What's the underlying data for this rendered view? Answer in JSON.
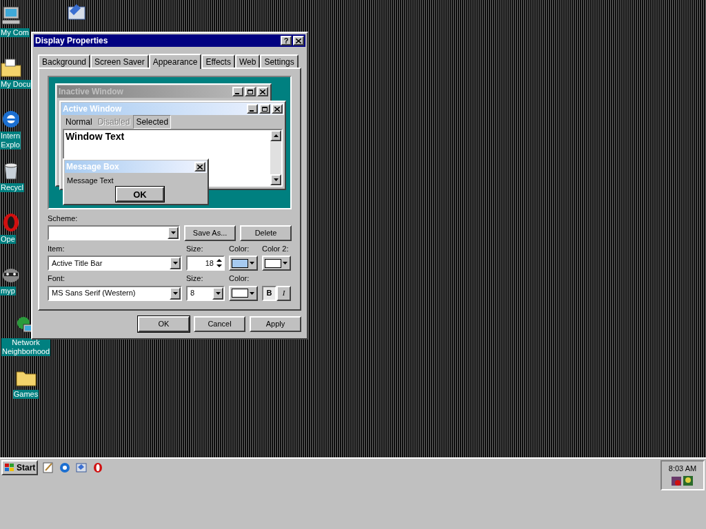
{
  "desktop_icons": [
    {
      "kind": "computer",
      "label": "My Com"
    },
    {
      "kind": "documents",
      "label": "My Docu"
    },
    {
      "kind": "browser",
      "label": "Intern",
      "label_2": "Explo"
    },
    {
      "kind": "recycle",
      "label": "Recycl"
    },
    {
      "kind": "opera",
      "label": "Ope"
    },
    {
      "kind": "raccoon",
      "label": "myp"
    },
    {
      "kind": "network",
      "label": "Network",
      "label_2": "Neighborhood"
    },
    {
      "kind": "folder",
      "label": "Games"
    }
  ],
  "dialog": {
    "title": "Display Properties",
    "help": "?",
    "tabs": [
      {
        "label": "Background",
        "selected": false
      },
      {
        "label": "Screen Saver",
        "selected": false
      },
      {
        "label": "Appearance",
        "selected": true
      },
      {
        "label": "Effects",
        "selected": false
      },
      {
        "label": "Web",
        "selected": false
      },
      {
        "label": "Settings",
        "selected": false
      }
    ],
    "preview": {
      "inactive_window": {
        "title": "Inactive Window"
      },
      "active_window": {
        "title": "Active Window",
        "menu": [
          {
            "label": "Normal",
            "disabled": false,
            "selected": false
          },
          {
            "label": "Disabled",
            "disabled": true,
            "selected": false
          },
          {
            "label": "Selected",
            "disabled": false,
            "selected": true
          }
        ],
        "window_text": "Window Text"
      },
      "message_box": {
        "title": "Message Box",
        "text": "Message Text",
        "button": "OK"
      }
    },
    "scheme": {
      "label": "Scheme:",
      "buttons": [
        "Save As...",
        "Delete"
      ]
    },
    "item": {
      "label": "Item:",
      "value": "Active Title Bar",
      "size_label": "Size:",
      "size": "18",
      "colors": [
        {
          "label": "Color:",
          "color": "#a6caf0"
        },
        {
          "label": "Color 2:",
          "color": "#ffffff"
        }
      ]
    },
    "font": {
      "label": "Font:",
      "value": "MS Sans Serif (Western)",
      "size_label": "Size:",
      "size": "8",
      "colors": [
        {
          "label": "Color:",
          "color": "#ffffff"
        }
      ],
      "bold_label": "B",
      "bold": true,
      "italic_label": "I",
      "italic": false
    },
    "buttons": [
      "OK",
      "Cancel",
      "Apply"
    ]
  },
  "taskbar": {
    "start": "Start",
    "quick_launch": [
      {
        "kind": "notepad"
      },
      {
        "kind": "browser"
      },
      {
        "kind": "outlook"
      },
      {
        "kind": "opera"
      }
    ],
    "clock": "8:03 AM"
  }
}
